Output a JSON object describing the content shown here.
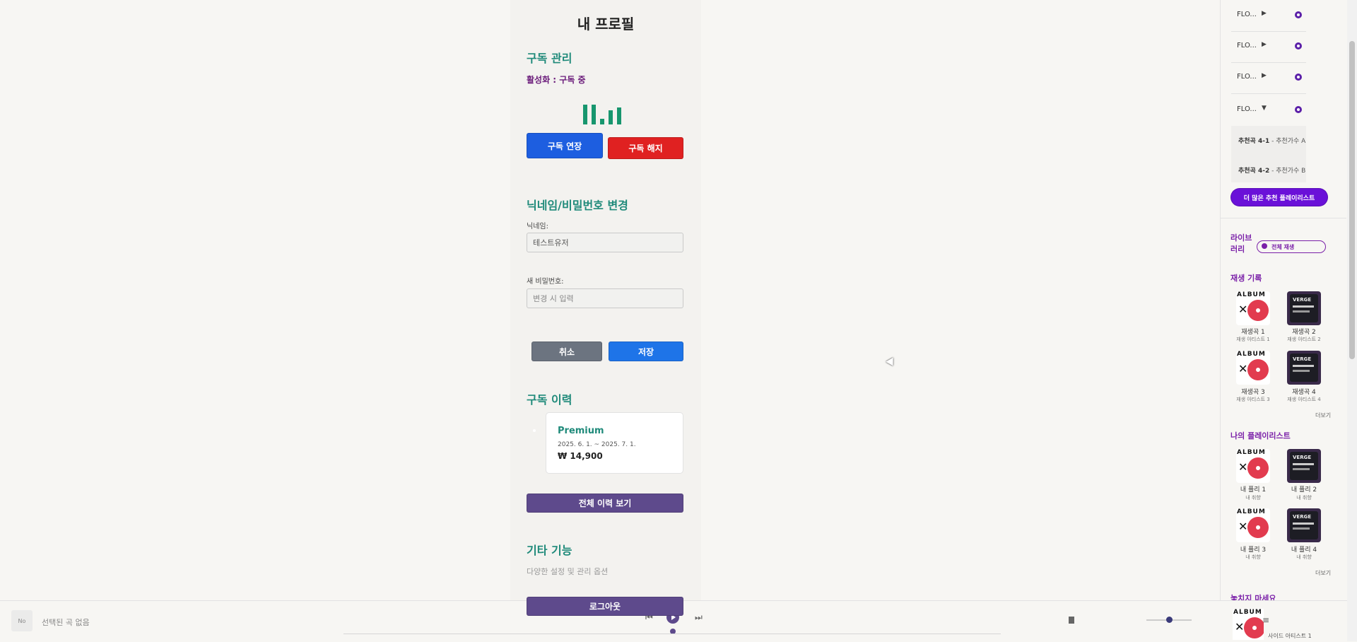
{
  "profile": {
    "title": "내 프로필",
    "subscription": {
      "section_title": "구독 관리",
      "status": "활성화 : 구독 중",
      "extend_label": "구독 연장",
      "cancel_label": "구독 해지"
    },
    "account": {
      "section_title": "닉네임/비밀번호 변경",
      "nickname_label": "닉네임:",
      "nickname_value": "테스트유저",
      "password_label": "새 비밀번호:",
      "password_placeholder": "변경 시 입력",
      "cancel_label": "취소",
      "save_label": "저장"
    },
    "history": {
      "section_title": "구독 이력",
      "plan": "Premium",
      "period": "2025. 6. 1. ~ 2025. 7. 1.",
      "price": "₩ 14,900",
      "view_all_label": "전체 이력 보기"
    },
    "etc": {
      "section_title": "기타 기능",
      "desc": "다양한 설정 및 관리 옵션",
      "logout_label": "로그아웃"
    }
  },
  "sidebar": {
    "recommend_rows": [
      {
        "name": "FLO...",
        "arrow": "▶"
      },
      {
        "name": "FLO...",
        "arrow": "▶"
      },
      {
        "name": "FLO...",
        "arrow": "▶"
      },
      {
        "name": "FLO...",
        "arrow": "▼"
      }
    ],
    "sub_items": [
      {
        "song": "추천곡 4-1",
        "artist": " - 추천가수 A"
      },
      {
        "song": "추천곡 4-2",
        "artist": " - 추천가수 B"
      }
    ],
    "more_playlists_label": "더 많은 추천 플레이리스트",
    "library_title_1": "라이브",
    "library_title_2": "러리",
    "play_all_label": "전체 재생",
    "history_title": "재생 기록",
    "history_items": [
      {
        "title": "재생곡 1",
        "artist": "재생 아티스트 1"
      },
      {
        "title": "재생곡 2",
        "artist": "재생 아티스트 2"
      },
      {
        "title": "재생곡 3",
        "artist": "재생 아티스트 3"
      },
      {
        "title": "재생곡 4",
        "artist": "재생 아티스트 4"
      }
    ],
    "more_label": "더보기",
    "playlists_title": "나의 플레이리스트",
    "playlist_items": [
      {
        "title": "내 플리 1",
        "sub": "내 취향"
      },
      {
        "title": "내 플리 2",
        "sub": "내 취향"
      },
      {
        "title": "내 플리 3",
        "sub": "내 취향"
      },
      {
        "title": "내 플리 4",
        "sub": "내 취향"
      }
    ],
    "more_label_2": "더보기",
    "dont_miss_title": "놓치지 마세요",
    "side_artist": "사이드 아티스트 1",
    "album_text": "ALBUM",
    "verge_text": "VERGE"
  },
  "player": {
    "thumb_text": "No",
    "no_song": "선택된 곡 없음"
  },
  "colors": {
    "accent_teal": "#1f8a7a",
    "blue": "#1d5ee0",
    "red": "#e02121",
    "purple": "#5e4a8c",
    "violet": "#6a11d8"
  }
}
